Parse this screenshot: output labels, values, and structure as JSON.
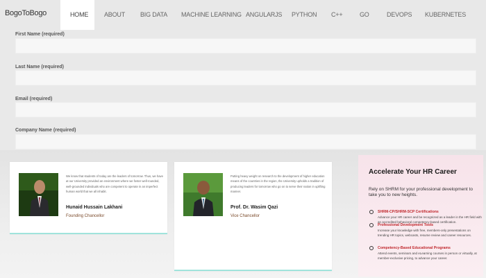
{
  "brand": "BogoToBogo",
  "nav": {
    "items": [
      "HOME",
      "ABOUT",
      "BIG DATA",
      "MACHINE LEARNING",
      "ANGULARJS",
      "PYTHON",
      "C++",
      "GO",
      "DEVOPS",
      "KUBERNETES"
    ],
    "active": "HOME"
  },
  "form": {
    "first_name_label": "First Name (required)",
    "last_name_label": "Last Name (required)",
    "email_label": "Email (required)",
    "company_label": "Company Name (required)",
    "first_name_value": "",
    "last_name_value": "",
    "email_value": "",
    "company_value": ""
  },
  "cards": [
    {
      "quote": "We know that students of today are the leaders of tomorrow. Thus, we have at our University provided an environment where we foster well-rounded, well-grounded individuals who are competent to operate in an imperfect human world that we all inhabit.",
      "name": "Hunaid Hussain Lakhani",
      "role": "Founding Chancellor"
    },
    {
      "quote": "Putting heavy weight on research to the development of higher education means of the countries in the region, the University upholds a tradition of producing leaders for tomorrow who go on to serve their nation in uplifting manner.",
      "name": "Prof. Dr. Wasim Qazi",
      "role": "Vice Chancellor"
    }
  ],
  "ad": {
    "title": "Accelerate Your HR Career",
    "subtitle": "Rely on SHRM for your professional development to take you to new heights.",
    "items": [
      {
        "heading": "SHRM-CP/SHRM-SCP Certifications",
        "text": "Advance your HR career and be recognized as a leader in the HR field with an accredited behavioral competency-based certification."
      },
      {
        "heading": "Professional Development Tools",
        "text": "Increase your knowledge with free, members-only presentations on trending HR topics, webcasts, resume review and career resources."
      },
      {
        "heading": "Competency-Based Educational Programs",
        "text": "Attend events, seminars and eLearning courses in person or virtually, at member-exclusive pricing, to advance your career."
      }
    ]
  },
  "colors": {
    "nav_bg": "#e8e8e8",
    "active_tab_bg": "#ffffff",
    "card_accent": "#9fe3dc",
    "role_color": "#7a4a2a",
    "ad_heading": "#c0282d",
    "ad_bg": "#f7e3ea"
  }
}
